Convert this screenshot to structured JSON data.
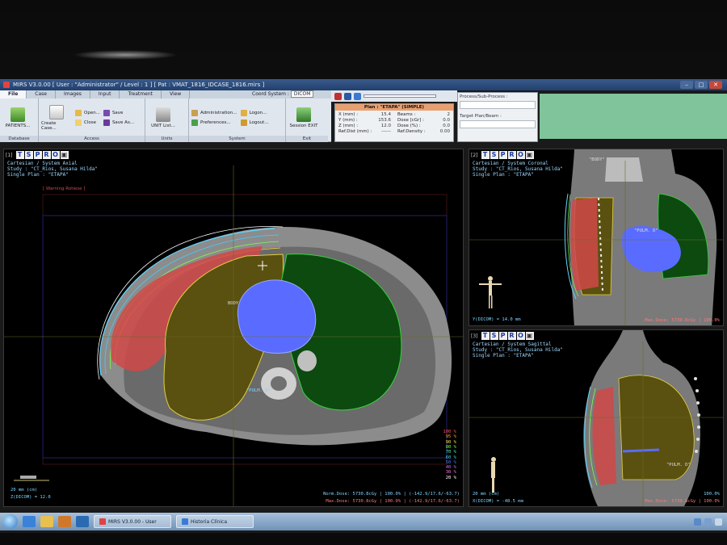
{
  "window": {
    "title": "MIRS  V3.0.00  [ User : \"Administrator\" / Level : 1 ]  [ Pat : VMAT_1816_IDCASE_1816.mirs ]",
    "minimize": "–",
    "maximize": "□",
    "close": "✕"
  },
  "ribbon": {
    "tabs": [
      "File",
      "Case",
      "Images",
      "Input",
      "Treatment",
      "View"
    ],
    "coord_label": "Coord System :",
    "coord_value": "DICOM",
    "groups": {
      "database": {
        "label": "Database",
        "patients": "PATIENTS..."
      },
      "access": {
        "label": "Access",
        "create": "Create Case...",
        "open": "Open...",
        "close": "Close",
        "save": "Save",
        "save_as": "Save As..."
      },
      "units": {
        "label": "Units",
        "unit_list": "UNIT List..."
      },
      "system": {
        "label": "System",
        "admin": "Administration...",
        "prefs": "Preferences...",
        "logon": "Logon...",
        "logout": "Logout..."
      },
      "exit": {
        "label": "Exit",
        "session_exit": "Session EXIT"
      }
    }
  },
  "plan": {
    "title": "Plan : \"ETAPA\" (SIMPLE)",
    "rows": [
      {
        "l": "X (mm) :",
        "v": "15.4",
        "l2": "Beams :",
        "v2": "2"
      },
      {
        "l": "Y (mm) :",
        "v": "153.6",
        "l2": "Dose [cGr] :",
        "v2": "0.0"
      },
      {
        "l": "Z (mm) :",
        "v": "12.0",
        "l2": "Dose (%) :",
        "v2": "0.0"
      },
      {
        "l": "Ref.Dist (mm) :",
        "v": "------",
        "l2": "Ref.Density :",
        "v2": "0.00"
      }
    ]
  },
  "process": {
    "process_label": "Process/Sub-Process :",
    "target_label": "Target Plan/Beam :"
  },
  "toolbar_letters": [
    "T",
    "S",
    "P",
    "R",
    "O"
  ],
  "views": {
    "axial": {
      "num": "[1]",
      "header": [
        "Cartesian / System Axial",
        "Study : \"CT_Rios, Susana Hilda\"",
        "Single Plan : \"ETAPA\""
      ],
      "warning": "[ Warning Rotiese ]",
      "labels": {
        "body": "BODY",
        "pulm": "\"PULM. D\""
      },
      "scale": "20 mm (cm)",
      "pos": "Z(DICOM) = 12.0",
      "norm_dose": "Norm.Dose: 5730.8cGy | 100.0% | (-142.9/17.6/-63.7)",
      "max_dose": "Max.Dose: 5730.8cGy | 100.0% | (-142.9/17.6/-63.7)",
      "legend": [
        {
          "pct": "100 %",
          "color": "#ff5050"
        },
        {
          "pct": "95 %",
          "color": "#ff9a40"
        },
        {
          "pct": "90 %",
          "color": "#ffe040"
        },
        {
          "pct": "80 %",
          "color": "#7cff4a"
        },
        {
          "pct": "70 %",
          "color": "#40ffb0"
        },
        {
          "pct": "60 %",
          "color": "#40d0ff"
        },
        {
          "pct": "50 %",
          "color": "#4a7cff"
        },
        {
          "pct": "40 %",
          "color": "#c070ff"
        },
        {
          "pct": "30 %",
          "color": "#ff70d0"
        },
        {
          "pct": "20 %",
          "color": "#ffffff"
        }
      ]
    },
    "coronal": {
      "num": "[2]",
      "header": [
        "Cartesian / System Coronal",
        "Study : \"CT_Rios, Susana Hilda\"",
        "Single Plan : \"ETAPA\""
      ],
      "labels": {
        "body": "\"BODY\"",
        "pulm": "\"PULM. D\""
      },
      "pos": "Y(DICOM) = 14.0 mm",
      "max_dose": "Max.Dose: 5730.8cGy | 100.0%"
    },
    "sagittal": {
      "num": "[3]",
      "header": [
        "Cartesian / System Sagittal",
        "Study : \"CT_Rios, Susana Hilda\"",
        "Single Plan : \"ETAPA\""
      ],
      "labels": {
        "pulm": "\"PULM. D\""
      },
      "scale": "20 mm (cm)",
      "pos": "X(DICOM) = -48.5 mm",
      "norm_dose": "100.0%",
      "max_dose": "Max.Dose: 5730.8cGy | 100.0%"
    }
  },
  "taskbar": {
    "tasks": [
      {
        "label": "MIRS V3.0.00 - User",
        "color": "#d44"
      },
      {
        "label": "Historia Clínica",
        "color": "#3a7bd5"
      }
    ]
  },
  "colors": {
    "ptv": "#e03a3a",
    "lung": "#5a5010",
    "lung_left": "#0c4a10",
    "heart": "#5a6cff",
    "body_contour": "#5fd6ff"
  }
}
